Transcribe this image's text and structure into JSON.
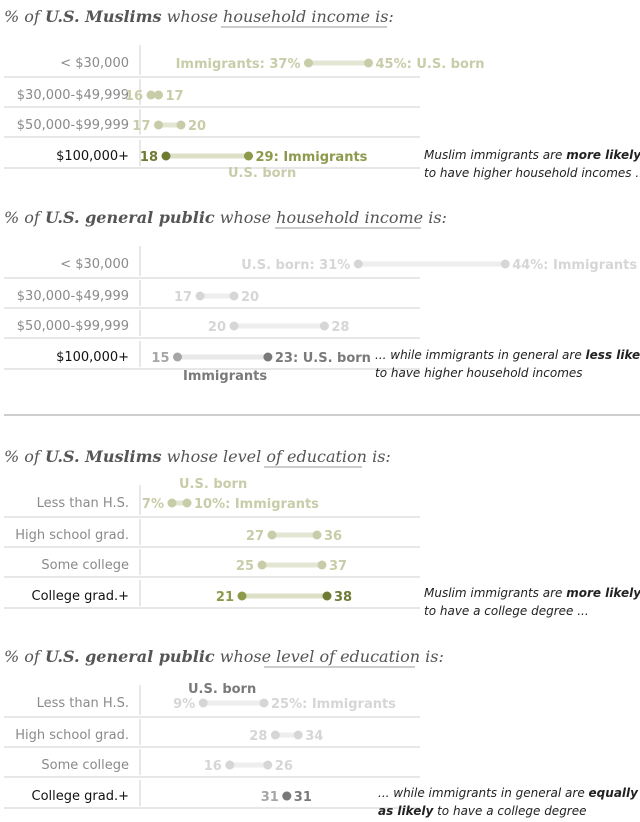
{
  "chart_data": [
    {
      "type": "dot-plot",
      "title": [
        "% of ",
        "U.S. Muslims",
        " whose ",
        "household income",
        " is:"
      ],
      "categories": [
        "< $30,000",
        "$30,000-$49,999",
        "$50,000-$99,999",
        "$100,000+"
      ],
      "series": [
        {
          "name": "Immigrants",
          "values": [
            37,
            16,
            17,
            29
          ]
        },
        {
          "name": "U.S. born",
          "values": [
            45,
            17,
            20,
            18
          ]
        }
      ],
      "value_labels": [
        [
          "Immigrants: 37%",
          "45%: U.S. born"
        ],
        [
          "16",
          "17"
        ],
        [
          "17",
          "20"
        ],
        [
          "29: Immigrants",
          "18"
        ]
      ],
      "extra_label": "U.S. born",
      "annotation": [
        "Muslim immigrants are ",
        "more likely",
        "to have higher household incomes ..."
      ]
    },
    {
      "type": "dot-plot",
      "title": [
        "% of ",
        "U.S. general public",
        " whose ",
        "household income",
        " is:"
      ],
      "categories": [
        "< $30,000",
        "$30,000-$49,999",
        "$50,000-$99,999",
        "$100,000+"
      ],
      "series": [
        {
          "name": "U.S. born",
          "values": [
            31,
            17,
            20,
            23
          ]
        },
        {
          "name": "Immigrants",
          "values": [
            44,
            20,
            28,
            15
          ]
        }
      ],
      "value_labels": [
        [
          "U.S. born: 31%",
          "44%: Immigrants"
        ],
        [
          "17",
          "20"
        ],
        [
          "20",
          "28"
        ],
        [
          "23: U.S. born",
          "15"
        ]
      ],
      "extra_label": "Immigrants",
      "annotation": [
        "... while immigrants in general are ",
        "less likely",
        "to have higher household incomes"
      ]
    },
    {
      "type": "dot-plot",
      "title": [
        "% of ",
        "U.S. Muslims",
        " whose ",
        "level of education",
        " is:"
      ],
      "categories": [
        "Less than H.S.",
        "High school grad.",
        "Some college",
        "College grad.+"
      ],
      "series": [
        {
          "name": "U.S. born",
          "values": [
            7,
            27,
            25,
            21
          ]
        },
        {
          "name": "Immigrants",
          "values": [
            10,
            36,
            37,
            38
          ]
        }
      ],
      "value_labels": [
        [
          "7%",
          "10%: Immigrants"
        ],
        [
          "27",
          "36"
        ],
        [
          "25",
          "37"
        ],
        [
          "21",
          "38"
        ]
      ],
      "extra_label": "U.S. born",
      "annotation": [
        "Muslim immigrants are ",
        "more likely",
        "to have a college degree ..."
      ]
    },
    {
      "type": "dot-plot",
      "title": [
        "% of ",
        "U.S. general public",
        " whose ",
        "level of education",
        " is:"
      ],
      "categories": [
        "Less than H.S.",
        "High school grad.",
        "Some college",
        "College grad.+"
      ],
      "series": [
        {
          "name": "U.S. born",
          "values": [
            9,
            28,
            16,
            31
          ]
        },
        {
          "name": "Immigrants",
          "values": [
            25,
            34,
            26,
            31
          ]
        }
      ],
      "value_labels": [
        [
          "9%",
          "25%: Immigrants"
        ],
        [
          "28",
          "34"
        ],
        [
          "16",
          "26"
        ],
        [
          "31",
          "31"
        ]
      ],
      "extra_label": "U.S. born",
      "annotation": [
        "... while immigrants in general are ",
        "equally",
        "as likely",
        " to have a college degree"
      ]
    }
  ],
  "colors": {
    "muslim_light": "#c9cca8",
    "muslim_dark": "#6f7a32",
    "muslim_mid": "#8d9a4b",
    "muslim_bar": "#dde0c6",
    "gp_light": "#d6d6d6",
    "gp_dark": "#7a7a7a",
    "gp_mid": "#a6a6a6",
    "gp_bar": "#e9e9e9",
    "rule": "#cfcfcf",
    "text": "#555555"
  }
}
